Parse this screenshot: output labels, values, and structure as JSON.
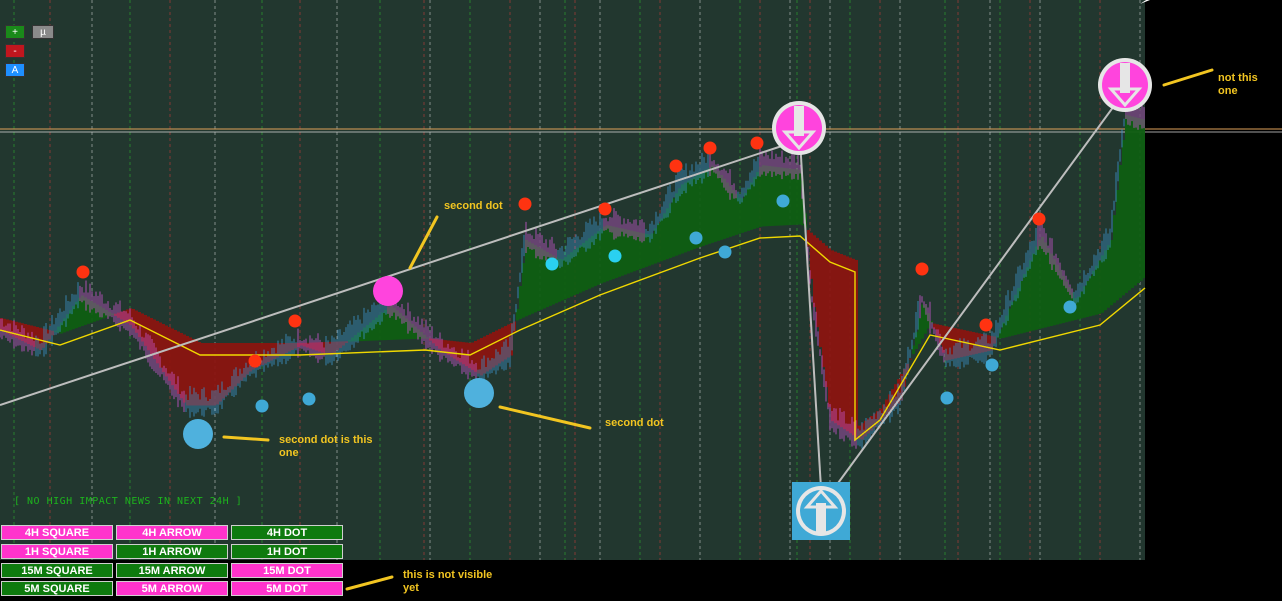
{
  "controls": {
    "zoom_in": "+",
    "mu": "µ",
    "zoom_out": "-",
    "auto": "A"
  },
  "news_text": "[ NO HIGH IMPACT NEWS IN NEXT 24H ]",
  "buttons": [
    {
      "label": "4H SQUARE",
      "state": "magenta"
    },
    {
      "label": "4H ARROW",
      "state": "magenta"
    },
    {
      "label": "4H DOT",
      "state": "green"
    },
    {
      "label": "1H SQUARE",
      "state": "magenta"
    },
    {
      "label": "1H ARROW",
      "state": "green"
    },
    {
      "label": "1H DOT",
      "state": "green"
    },
    {
      "label": "15M SQUARE",
      "state": "green"
    },
    {
      "label": "15M ARROW",
      "state": "green"
    },
    {
      "label": "15M DOT",
      "state": "magenta"
    },
    {
      "label": "5M SQUARE",
      "state": "green"
    },
    {
      "label": "5M ARROW",
      "state": "magenta"
    },
    {
      "label": "5M DOT",
      "state": "magenta"
    }
  ],
  "annotations": {
    "second_dot_top": "second dot",
    "second_dot_is_this_one": "second dot is this one",
    "second_dot_mid": "second dot",
    "not_this_one": "not this one",
    "not_visible_yet": "this is not visible yet"
  },
  "colors": {
    "chart_bg": "#22372f",
    "outside_bg": "#000000",
    "magenta": "#ff33cc",
    "green": "#0e7a0e",
    "annotation": "#f2c521",
    "top_dot": "#ff3311",
    "bottom_dot": "#3fa9d6"
  }
}
